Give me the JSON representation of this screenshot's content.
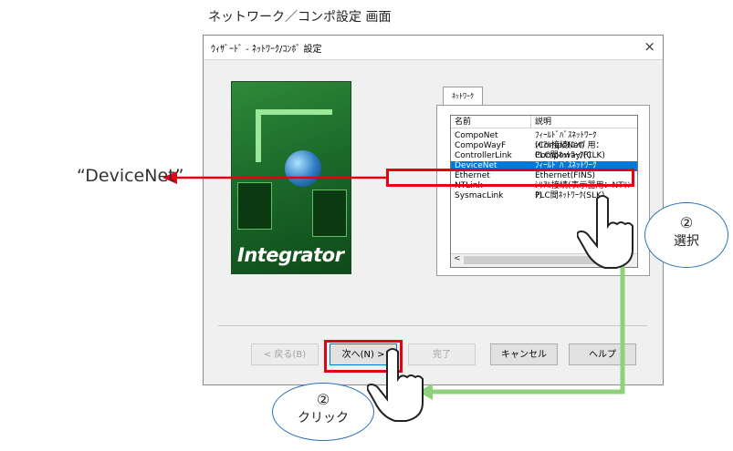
{
  "caption": "ネットワーク／コンポ設定 画面",
  "callout": "“DeviceNet”",
  "dialog": {
    "title": "ｳｨｻﾞｰﾄﾞ - ﾈｯﾄﾜｰｸ/ｺﾝﾎﾟ 設定",
    "close_glyph": "×",
    "hero_text": "Integrator",
    "tab_label": "ﾈｯﾄﾜｰｸ",
    "list": {
      "columns": [
        "名前",
        "説明"
      ],
      "rows": [
        {
          "name": "CompoNet",
          "desc": "ﾌｨｰﾙﾄﾞﾊﾞｽﾈｯﾄﾜｰｸ(CompoNet)"
        },
        {
          "name": "CompoWayF",
          "desc": "ｼﾘｱﾙ接続(ｺﾝﾎﾟ用：Compoway/F)"
        },
        {
          "name": "ControllerLink",
          "desc": "PLC間ﾈｯﾄﾜｰｸ(CLK)"
        },
        {
          "name": "DeviceNet",
          "desc": "ﾌｨｰﾙﾄﾞﾊﾞｽﾈｯﾄﾜｰｸ(DeviceNet)"
        },
        {
          "name": "Ethernet",
          "desc": "Ethernet(FINS)"
        },
        {
          "name": "NTLink",
          "desc": "ｼﾘｱﾙ接続(表示器用：NTﾘﾝｸ)"
        },
        {
          "name": "SysmacLink",
          "desc": "PLC間ﾈｯﾄﾜｰｸ(SLK)"
        }
      ],
      "selected_index": 3
    },
    "buttons": {
      "back": "< 戻る(B)",
      "next": "次へ(N) >",
      "finish": "完了",
      "cancel": "キャンセル",
      "help": "ヘルプ"
    }
  },
  "annotations": {
    "select": {
      "num": "②",
      "text": "選択"
    },
    "click": {
      "num": "②",
      "text": "クリック"
    }
  },
  "colors": {
    "highlight": "#e60012",
    "arrow_green": "#8fd07a",
    "selection": "#0078d7"
  }
}
